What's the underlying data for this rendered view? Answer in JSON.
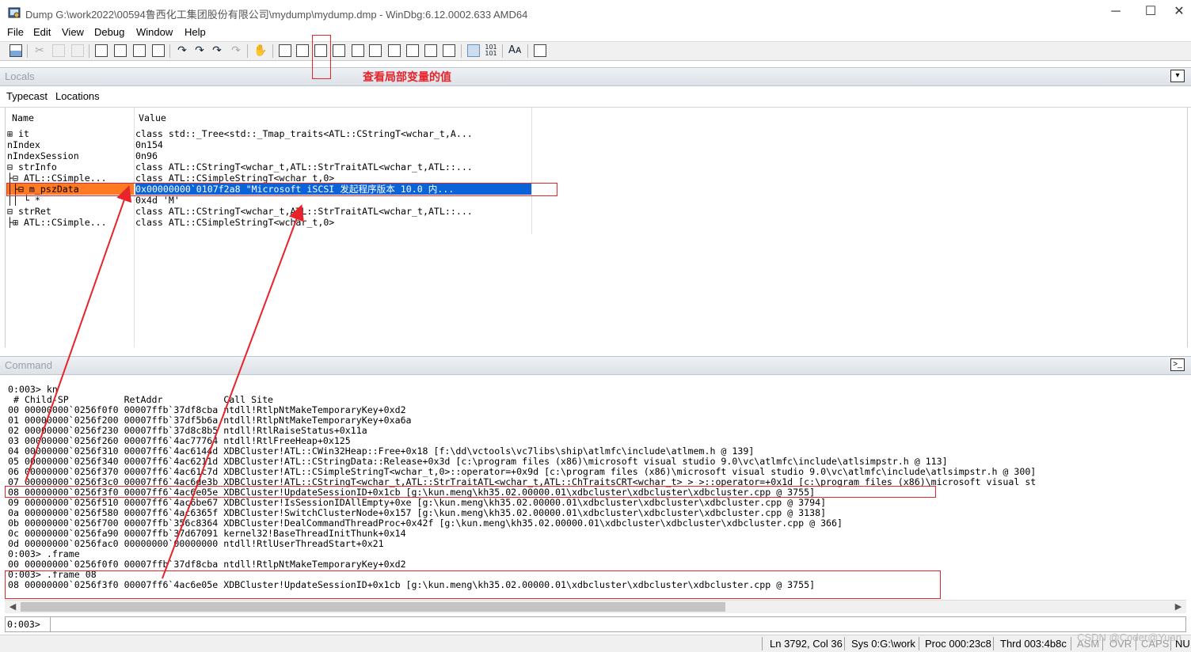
{
  "window": {
    "title": "Dump G:\\work2022\\00594鲁西化工集团股份有限公司\\mydump\\mydump.dmp - WinDbg:6.12.0002.633 AMD64",
    "minimize": "─",
    "maximize": "☐",
    "close": "✕"
  },
  "menu": [
    "File",
    "Edit",
    "View",
    "Debug",
    "Window",
    "Help"
  ],
  "annotation": "查看局部变量的值",
  "locals": {
    "pane_title": "Locals",
    "options": [
      "Typecast",
      "Locations"
    ],
    "columns": [
      "Name",
      "Value"
    ],
    "rows": [
      {
        "name": "⊞ it",
        "value": "class std::_Tree<std::_Tmap_traits<ATL::CStringT<wchar_t,A..."
      },
      {
        "name": "  nIndex",
        "value": "0n154"
      },
      {
        "name": "  nIndexSession",
        "value": "0n96"
      },
      {
        "name": "⊟ strInfo",
        "value": "class ATL::CStringT<wchar_t,ATL::StrTraitATL<wchar_t,ATL::..."
      },
      {
        "name": " ├⊟ ATL::CSimple...",
        "value": "class ATL::CSimpleStringT<wchar_t,0>"
      },
      {
        "name": " │├⊟ m_pszData",
        "value": "0x00000000`0107f2a8 \"Microsoft iSCSI 发起程序版本 10.0 内..."
      },
      {
        "name": " ││ └ *",
        "value": "0x4d 'M'"
      },
      {
        "name": "⊟ strRet",
        "value": "class ATL::CStringT<wchar_t,ATL::StrTraitATL<wchar_t,ATL::..."
      },
      {
        "name": " ├⊞ ATL::CSimple...",
        "value": "class ATL::CSimpleStringT<wchar_t,0>"
      }
    ]
  },
  "command": {
    "pane_title": "Command",
    "lines": [
      "0:003> kn",
      " # Child-SP          RetAddr           Call Site",
      "00 00000000`0256f0f0 00007ffb`37df8cba ntdll!RtlpNtMakeTemporaryKey+0xd2",
      "01 00000000`0256f200 00007ffb`37df5b6a ntdll!RtlpNtMakeTemporaryKey+0xa6a",
      "02 00000000`0256f230 00007ffb`37d8c8b5 ntdll!RtlRaiseStatus+0x11a",
      "03 00000000`0256f260 00007ff6`4ac77764 ntdll!RtlFreeHeap+0x125",
      "04 00000000`0256f310 00007ff6`4ac6144d XDBCluster!ATL::CWin32Heap::Free+0x18 [f:\\dd\\vctools\\vc7libs\\ship\\atlmfc\\include\\atlmem.h @ 139]",
      "05 00000000`0256f340 00007ff6`4ac6211d XDBCluster!ATL::CStringData::Release+0x3d [c:\\program files (x86)\\microsoft visual studio 9.0\\vc\\atlmfc\\include\\atlsimpstr.h @ 113]",
      "06 00000000`0256f370 00007ff6`4ac61c7d XDBCluster!ATL::CSimpleStringT<wchar_t,0>::operator=+0x9d [c:\\program files (x86)\\microsoft visual studio 9.0\\vc\\atlmfc\\include\\atlsimpstr.h @ 300]",
      "07 00000000`0256f3c0 00007ff6`4ac6de3b XDBCluster!ATL::CStringT<wchar_t,ATL::StrTraitATL<wchar_t,ATL::ChTraitsCRT<wchar_t> > >::operator=+0x1d [c:\\program files (x86)\\microsoft visual st",
      "08 00000000`0256f3f0 00007ff6`4ac6e05e XDBCluster!UpdateSessionID+0x1cb [g:\\kun.meng\\kh35.02.00000.01\\xdbcluster\\xdbcluster\\xdbcluster.cpp @ 3755]",
      "09 00000000`0256f510 00007ff6`4ac6be67 XDBCluster!IsSessionIDAllEmpty+0xe [g:\\kun.meng\\kh35.02.00000.01\\xdbcluster\\xdbcluster\\xdbcluster.cpp @ 3794]",
      "0a 00000000`0256f580 00007ff6`4ac6365f XDBCluster!SwitchClusterNode+0x157 [g:\\kun.meng\\kh35.02.00000.01\\xdbcluster\\xdbcluster\\xdbcluster.cpp @ 3138]",
      "0b 00000000`0256f700 00007ffb`356c8364 XDBCluster!DealCommandThreadProc+0x42f [g:\\kun.meng\\kh35.02.00000.01\\xdbcluster\\xdbcluster\\xdbcluster.cpp @ 366]",
      "0c 00000000`0256fa90 00007ffb`37d67091 kernel32!BaseThreadInitThunk+0x14",
      "0d 00000000`0256fac0 00000000`00000000 ntdll!RtlUserThreadStart+0x21",
      "0:003> .frame",
      "00 00000000`0256f0f0 00007ffb`37df8cba ntdll!RtlpNtMakeTemporaryKey+0xd2",
      "0:003> .frame 08",
      "08 00000000`0256f3f0 00007ff6`4ac6e05e XDBCluster!UpdateSessionID+0x1cb [g:\\kun.meng\\kh35.02.00000.01\\xdbcluster\\xdbcluster\\xdbcluster.cpp @ 3755]"
    ],
    "prompt": "0:003>",
    "input_value": ""
  },
  "status": {
    "ln_col": "Ln 3792, Col 36",
    "sys": "Sys 0:G:\\work",
    "proc": "Proc 000:23c8",
    "thrd": "Thrd 003:4b8c",
    "asm": "ASM",
    "ovr": "OVR",
    "caps": "CAPS",
    "num": "NU"
  },
  "watermark": "CSDN @Coder@Yuan",
  "colors": {
    "selection_blue": "#0a64d8",
    "selection_orange": "#ff7a22",
    "annotation_red": "#e8232a"
  }
}
